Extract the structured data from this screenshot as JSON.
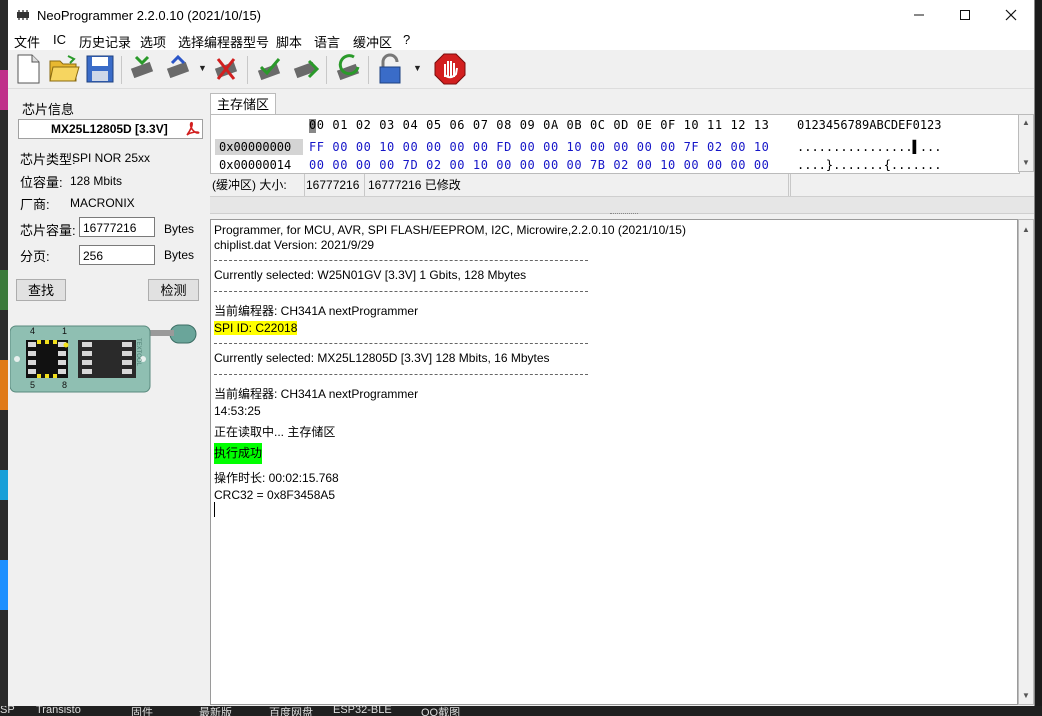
{
  "window": {
    "title": "NeoProgrammer 2.2.0.10 (2021/10/15)"
  },
  "menu": [
    "文件",
    "IC",
    "历史记录",
    "选项",
    "选择编程器型号",
    "脚本",
    "语言",
    "缓冲区",
    "?"
  ],
  "left_panel": {
    "chip_info_label": "芯片信息",
    "chip_name": "MX25L12805D [3.3V]",
    "type_label": "芯片类型:",
    "type_value": "SPI NOR 25xx",
    "capacity_label": "位容量:",
    "capacity_value": "128 Mbits",
    "vendor_label": "厂商:",
    "vendor_value": "MACRONIX",
    "chip_size_label": "芯片容量:",
    "chip_size_value": "16777216",
    "chip_size_unit": "Bytes",
    "page_label": "分页:",
    "page_value": "256",
    "page_unit": "Bytes",
    "find_button": "查找",
    "detect_button": "检测",
    "socket": {
      "pin_1": "1",
      "pin_4": "4",
      "pin_5": "5",
      "pin_8": "8",
      "brand": "TEXTOOL"
    }
  },
  "tab": {
    "label": "主存储区"
  },
  "hex": {
    "header_cols": "00 01 02 03 04 05 06 07 08 09 0A 0B 0C 0D 0E 0F 10 11 12 13",
    "header_ascii": "0123456789ABCDEF0123",
    "rows": [
      {
        "addr": "0x00000000",
        "bytes": "FF 00 00 10 00 00 00 00 FD 00 00 10 00 00 00 00 7F 02 00 10",
        "ascii": "................▌..."
      },
      {
        "addr": "0x00000014",
        "bytes": "00 00 00 00 7D 02 00 10 00 00 00 00 7B 02 00 10 00 00 00 00",
        "ascii": "....}.......{......."
      }
    ]
  },
  "status": {
    "buffer_label": "(缓冲区) 大小:",
    "size_value": "16777216",
    "modified": "16777216 已修改"
  },
  "log": {
    "l1": "Programmer, for MCU, AVR, SPI FLASH/EEPROM, I2C, Microwire,2.2.0.10 (2021/10/15)",
    "l2": "chiplist.dat Version: 2021/9/29",
    "l3": "Currently selected: W25N01GV [3.3V] 1 Gbits, 128 Mbytes",
    "l4": "当前编程器: CH341A nextProgrammer",
    "l5": "SPI ID: C22018",
    "l6": "Currently selected: MX25L12805D [3.3V] 128 Mbits, 16 Mbytes",
    "l7": "当前编程器: CH341A nextProgrammer",
    "l8": "14:53:25",
    "l9": "正在读取中... 主存储区",
    "l10": "执行成功",
    "l11": "操作时长: 00:02:15.768",
    "l12": "CRC32 = 0x8F3458A5"
  },
  "taskbar": [
    "SP",
    "Transisto",
    "固件",
    "最新版",
    "百度网盘",
    "ESP32-BLE",
    "QQ截图"
  ],
  "icons": {
    "toolbar": [
      "new-file-icon",
      "open-folder-icon",
      "save-icon",
      "read-chip-icon",
      "write-chip-icon",
      "erase-chip-icon",
      "verify-chip-icon",
      "blank-check-icon",
      "auto-icon",
      "protect-lock-icon",
      "stop-icon"
    ]
  },
  "colors": {
    "log_highlight_yellow": "#ffff00",
    "log_highlight_green": "#00ff00",
    "hex_value_blue": "#1515c8",
    "stop_red": "#d21f1f"
  }
}
